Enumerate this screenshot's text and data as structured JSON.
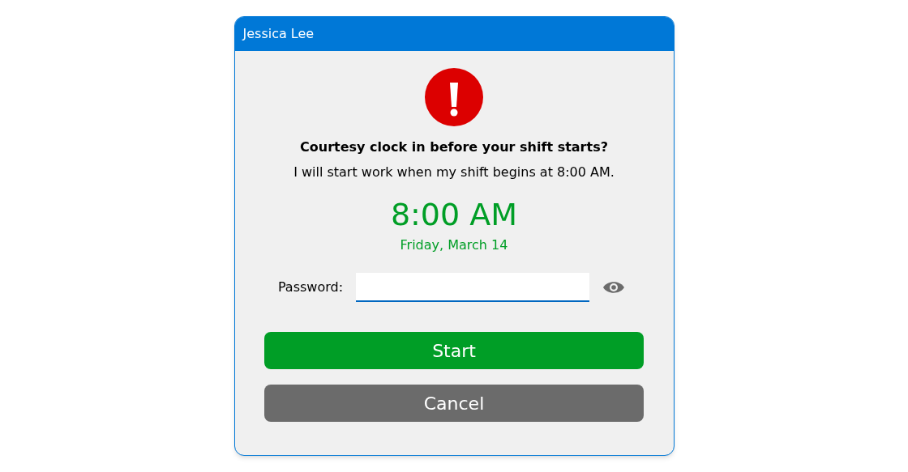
{
  "window": {
    "title": "Jessica Lee"
  },
  "message": {
    "heading": "Courtesy clock in before your shift starts?",
    "body": "I will start work when my shift begins at 8:00 AM."
  },
  "clock": {
    "time": "8:00 AM",
    "date": "Friday, March 14"
  },
  "password": {
    "label": "Password:"
  },
  "buttons": [
    {
      "label": "Start",
      "kind": "primary"
    },
    {
      "label": "Cancel",
      "kind": "secondary"
    }
  ]
}
